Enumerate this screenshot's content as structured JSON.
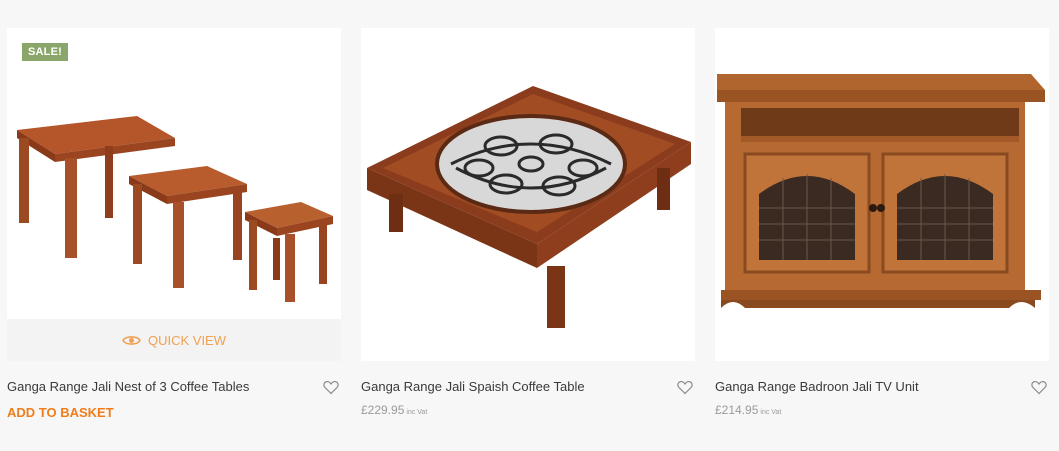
{
  "products": [
    {
      "title": "Ganga Range Jali Nest of 3 Coffee Tables",
      "badge": "SALE!",
      "quick_view": "QUICK VIEW",
      "action": "ADD TO BASKET",
      "image_icon": "nest-of-tables-image"
    },
    {
      "title": "Ganga Range Jali Spaish Coffee Table",
      "price": "£229.95",
      "vat": "inc Vat",
      "image_icon": "coffee-table-image"
    },
    {
      "title": "Ganga Range Badroon Jali TV Unit",
      "price": "£214.95",
      "vat": "inc Vat",
      "image_icon": "tv-unit-image"
    }
  ],
  "colors": {
    "sale_badge": "#8aa66a",
    "accent": "#f07d1a",
    "quick_view": "#f0a050",
    "wood": "#a0461e"
  }
}
